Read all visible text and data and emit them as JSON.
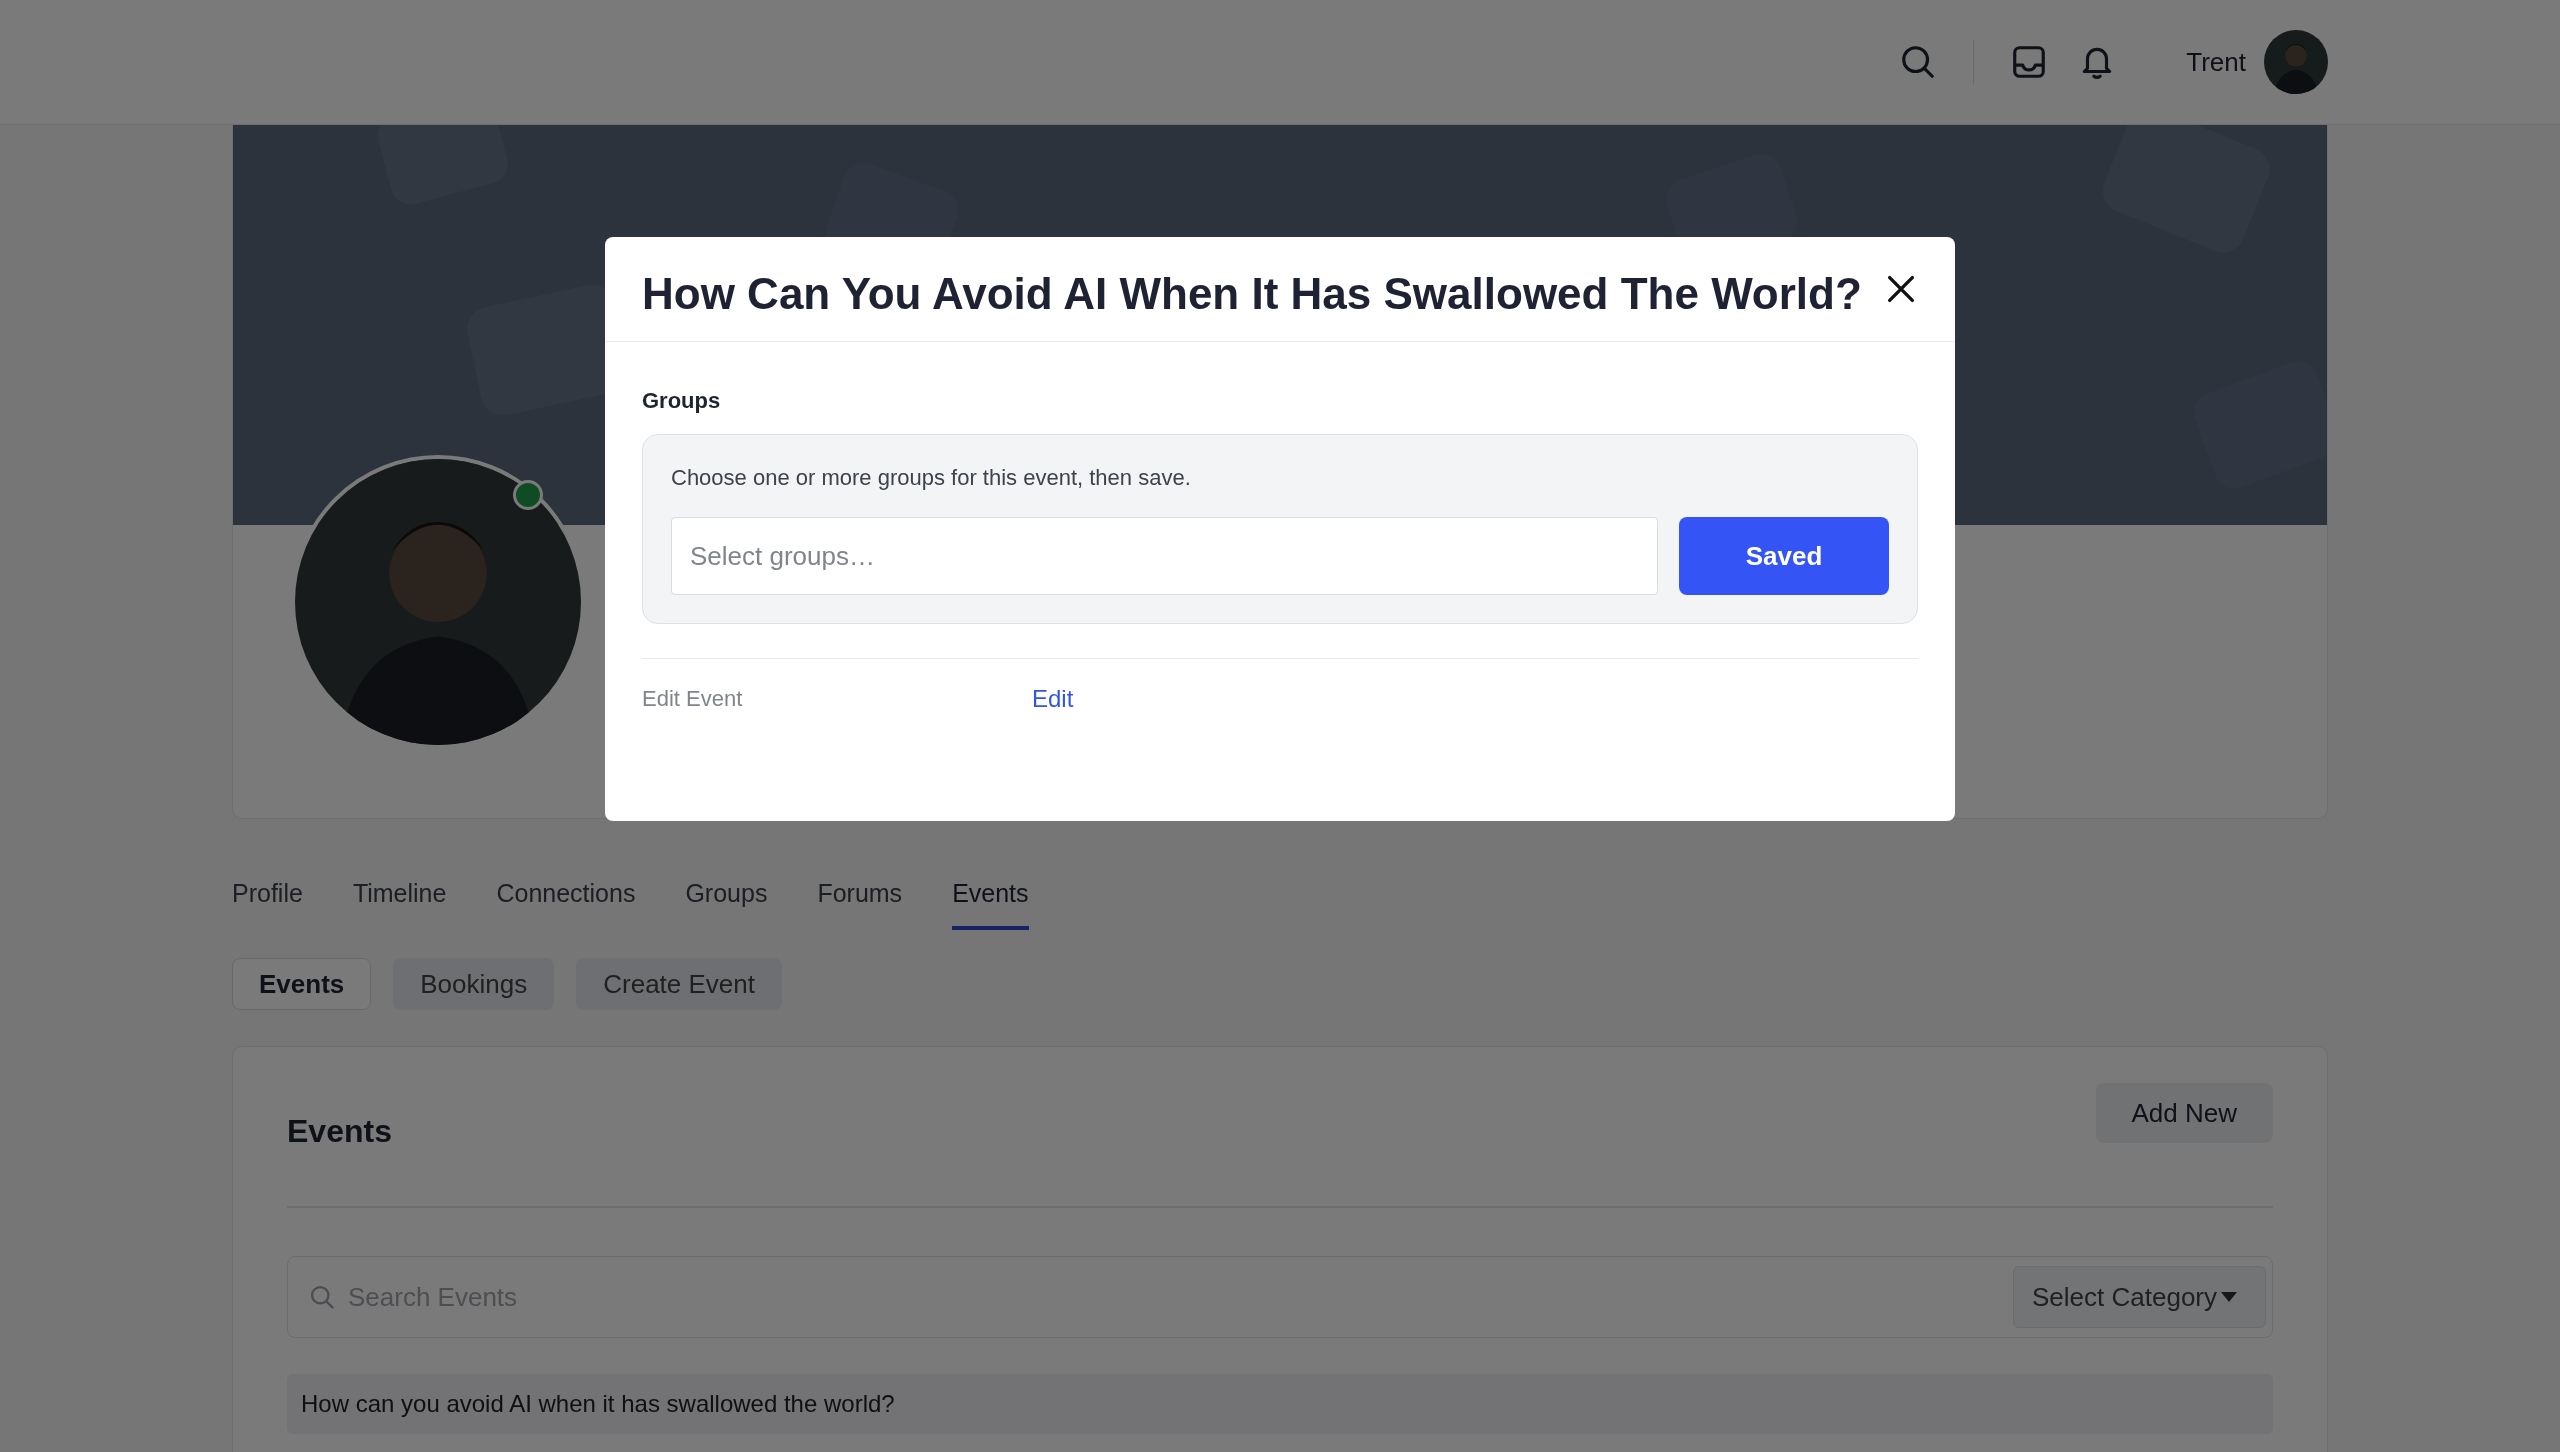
{
  "header": {
    "user_name": "Trent"
  },
  "profile": {
    "online": true
  },
  "profile_tabs": [
    {
      "label": "Profile",
      "selected": false
    },
    {
      "label": "Timeline",
      "selected": false
    },
    {
      "label": "Connections",
      "selected": false
    },
    {
      "label": "Groups",
      "selected": false
    },
    {
      "label": "Forums",
      "selected": false
    },
    {
      "label": "Events",
      "selected": true
    }
  ],
  "sub_tabs": [
    {
      "label": "Events",
      "selected": true
    },
    {
      "label": "Bookings",
      "selected": false
    },
    {
      "label": "Create Event",
      "selected": false
    }
  ],
  "events": {
    "title": "Events",
    "add_button": "Add New",
    "search": {
      "placeholder": "Search Events"
    },
    "category_select": "Select Category",
    "rows": [
      "How can you avoid AI when it has swallowed the world?"
    ]
  },
  "modal": {
    "title": "How Can You Avoid AI When It Has Swallowed The World?",
    "section_label": "Groups",
    "hint": "Choose one or more groups for this event, then save.",
    "groups_field": {
      "placeholder": "Select groups…"
    },
    "save_button": "Saved",
    "edit_label": "Edit Event",
    "edit_link": "Edit"
  }
}
